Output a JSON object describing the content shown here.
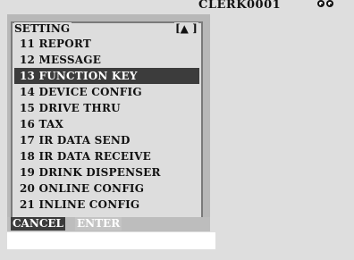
{
  "header": {
    "clerk": "CLERK0001"
  },
  "menu": {
    "title": "SETTING",
    "scroll_indicator": "[▲ ]",
    "items": [
      {
        "label": "11 REPORT"
      },
      {
        "label": "12 MESSAGE"
      },
      {
        "label": "13 FUNCTION KEY",
        "selected": true
      },
      {
        "label": "14 DEVICE CONFIG"
      },
      {
        "label": "15 DRIVE THRU"
      },
      {
        "label": "16 TAX"
      },
      {
        "label": "17 IR DATA SEND"
      },
      {
        "label": "18 IR DATA RECEIVE"
      },
      {
        "label": "19 DRINK DISPENSER"
      },
      {
        "label": "20 ONLINE CONFIG"
      },
      {
        "label": "21 INLINE CONFIG"
      }
    ]
  },
  "footer": {
    "cancel_label": "CANCEL",
    "enter_label": "ENTER"
  },
  "icons": {
    "status": [
      "ring-icon",
      "ring-icon"
    ]
  }
}
